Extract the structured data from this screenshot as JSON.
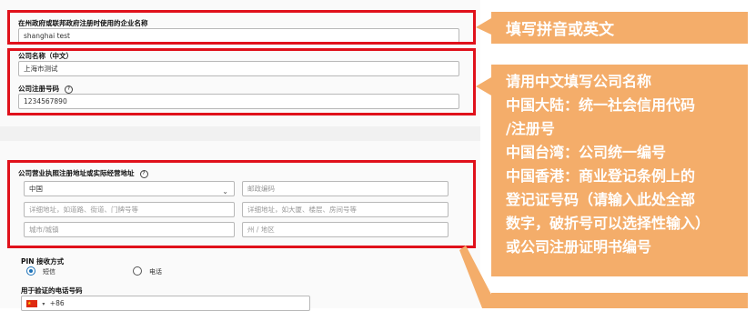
{
  "company_name_en": {
    "label": "在州政府或联邦政府注册时使用的企业名称",
    "value": "shanghai test"
  },
  "company_name_cn": {
    "label": "公司名称（中文）",
    "value": "上海市测试"
  },
  "registration_number": {
    "label": "公司注册号码",
    "help_icon": "?",
    "value": "1234567890"
  },
  "address": {
    "label": "公司营业执照注册地址或实际经营地址",
    "help_icon": "?",
    "country": "中国",
    "postal_placeholder": "邮政编码",
    "address1_placeholder": "详细地址，如道路、街道、门牌号等",
    "address2_placeholder": "详细地址，如大厦、楼层、房间号等",
    "city_placeholder": "城市/城镇",
    "state_placeholder": "州 / 地区"
  },
  "pin": {
    "label": "PIN 接收方式",
    "options": [
      "短信",
      "电话"
    ],
    "selected": "短信"
  },
  "phone": {
    "label": "用于验证的电话号码",
    "country_code": "+86"
  },
  "callouts": {
    "top": "填写拼音或英文",
    "middle": [
      "请用中文填写公司名称",
      "中国大陆：统一社会信用代码",
      "/注册号",
      "中国台湾：公司统一编号",
      "中国香港：商业登记条例上的",
      "登记证号码（请输入此处全部",
      "数字，破折号可以选择性输入）",
      "或公司注册证明书编号"
    ]
  },
  "colors": {
    "highlight_border": "#e0111b",
    "callout_bg": "#f4ad6a",
    "radio_selected": "#1d72b8"
  }
}
